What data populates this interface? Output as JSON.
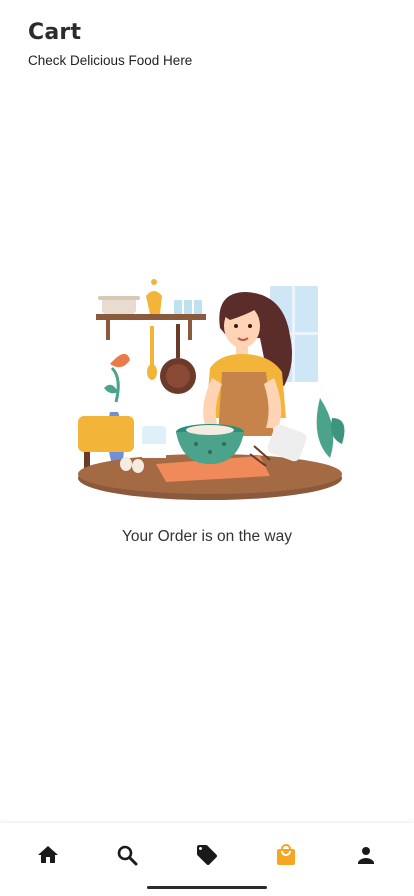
{
  "header": {
    "title": "Cart",
    "subtitle": "Check Delicious Food Here"
  },
  "main": {
    "message": "Your Order is on the way",
    "illustration_icon": "woman-cooking-illustration"
  },
  "nav": {
    "active": "cart",
    "active_color": "#F5A623",
    "inactive_color": "#1a1a1a",
    "items": [
      {
        "id": "home",
        "icon": "home-icon"
      },
      {
        "id": "search",
        "icon": "search-icon"
      },
      {
        "id": "offers",
        "icon": "tag-icon"
      },
      {
        "id": "cart",
        "icon": "shopping-bag-icon"
      },
      {
        "id": "profile",
        "icon": "person-icon"
      }
    ]
  }
}
